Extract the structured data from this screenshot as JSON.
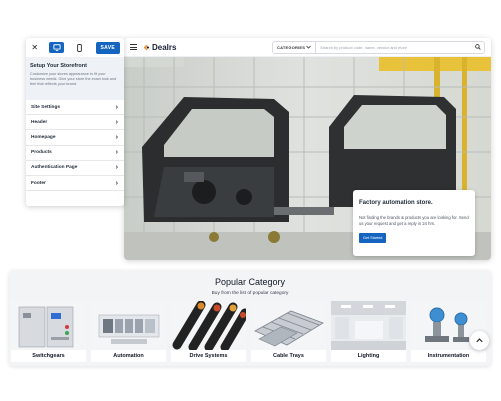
{
  "editor": {
    "close_glyph": "✕",
    "save_label": "SAVE",
    "title": "Setup Your Storefront",
    "description": "Customize your stores appearance to fit your business needs. Give your store the exact look and feel that reflects your brand.",
    "items": [
      {
        "label": "Site Settings"
      },
      {
        "label": "Header"
      },
      {
        "label": "Homepage"
      },
      {
        "label": "Products"
      },
      {
        "label": "Authentication Page"
      },
      {
        "label": "Footer"
      }
    ]
  },
  "storefront": {
    "logo_text": "Dealrs",
    "search": {
      "category_label": "CATEGORIES",
      "placeholder": "Search by product code, name, vendor and more"
    },
    "hero": {
      "title": "Factory automation store.",
      "text": "Not finding the brands & products you are looking for. Send us your request and get a reply in 24 hrs.",
      "button": "Get Started"
    }
  },
  "popular": {
    "title": "Popular Category",
    "subtitle": "Buy from the list of popular category",
    "categories": [
      {
        "label": "Switchgears"
      },
      {
        "label": "Automation"
      },
      {
        "label": "Drive Systems"
      },
      {
        "label": "Cable Trays"
      },
      {
        "label": "Lighting"
      },
      {
        "label": "Instrumentation"
      }
    ]
  },
  "colors": {
    "accent": "#1565c0",
    "logo_orange": "#f28c28"
  }
}
